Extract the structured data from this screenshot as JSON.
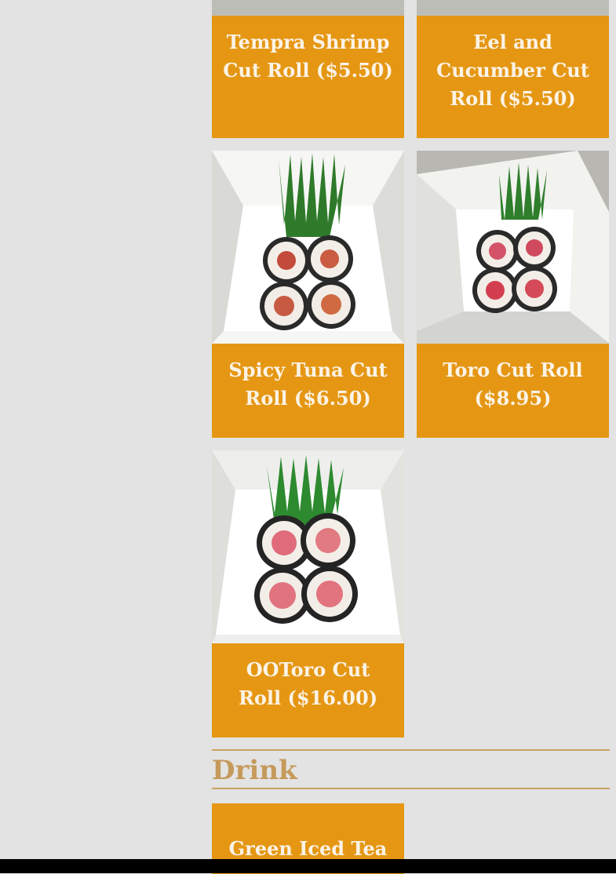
{
  "menu": {
    "items": [
      {
        "label": "Tempra Shrimp Cut Roll ($5.50)"
      },
      {
        "label": "Eel and Cucumber Cut Roll ($5.50)"
      },
      {
        "label": "Spicy Tuna Cut Roll ($6.50)"
      },
      {
        "label": "Toro Cut Roll ($8.95)"
      },
      {
        "label": "OOToro Cut Roll ($16.00)"
      }
    ],
    "drink_section": {
      "title": "Drink",
      "items": [
        {
          "label": "Green Iced Tea"
        }
      ]
    }
  },
  "colors": {
    "card": "#e59714",
    "section_title": "#c59a5b",
    "background": "#e3e3e3"
  }
}
